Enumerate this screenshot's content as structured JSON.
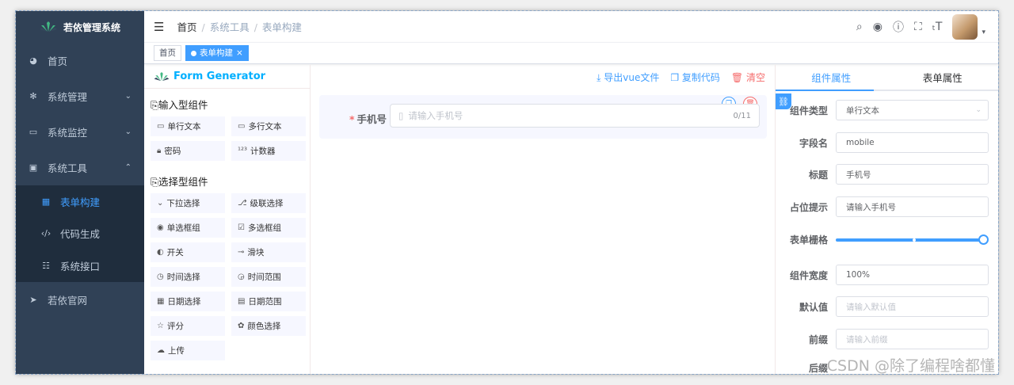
{
  "sidebar": {
    "app_title": "若依管理系统",
    "items": [
      {
        "label": "首页",
        "icon": "dashboard-icon"
      },
      {
        "label": "系统管理",
        "icon": "gear-icon"
      },
      {
        "label": "系统监控",
        "icon": "monitor-icon"
      },
      {
        "label": "系统工具",
        "icon": "toolbox-icon"
      }
    ],
    "subitems": [
      {
        "label": "表单构建",
        "icon": "table-icon"
      },
      {
        "label": "代码生成",
        "icon": "code-icon"
      },
      {
        "label": "系统接口",
        "icon": "sliders-icon"
      }
    ],
    "bottom_item": {
      "label": "若依官网",
      "icon": "send-icon"
    }
  },
  "breadcrumb": {
    "home": "首页",
    "parent": "系统工具",
    "current": "表单构建"
  },
  "tags": {
    "home": "首页",
    "active": "表单构建"
  },
  "generator": {
    "title": "Form Generator",
    "input_group": "输入型组件",
    "input_components": [
      "单行文本",
      "多行文本",
      "密码",
      "计数器"
    ],
    "select_group": "选择型组件",
    "select_components": [
      "下拉选择",
      "级联选择",
      "单选框组",
      "多选框组",
      "开关",
      "滑块",
      "时间选择",
      "时间范围",
      "日期选择",
      "日期范围",
      "评分",
      "颜色选择",
      "上传"
    ]
  },
  "actions": {
    "export": "导出vue文件",
    "copy": "复制代码",
    "clear": "清空"
  },
  "canvas_field": {
    "label": "手机号",
    "placeholder": "请输入手机号",
    "count": "0/11"
  },
  "props": {
    "tab_component": "组件属性",
    "tab_form": "表单属性",
    "type_label": "组件类型",
    "type_value": "单行文本",
    "field_label": "字段名",
    "field_value": "mobile",
    "title_label": "标题",
    "title_value": "手机号",
    "placeholder_label": "占位提示",
    "placeholder_value": "请输入手机号",
    "grid_label": "表单栅格",
    "grid_fraction": 1.0,
    "width_label": "组件宽度",
    "width_value": "100%",
    "default_label": "默认值",
    "default_placeholder": "请输入默认值",
    "prefix_label": "前缀",
    "prefix_placeholder": "请输入前缀",
    "suffix_label": "后缀"
  },
  "watermark": "CSDN @除了编程啥都懂",
  "colors": {
    "sidebar": "#304156",
    "accent": "#409eff",
    "danger": "#f56c6c"
  }
}
